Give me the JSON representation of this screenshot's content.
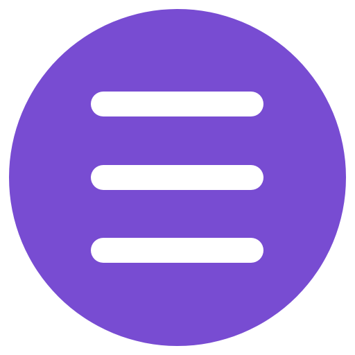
{
  "menu_button": {
    "icon": "hamburger-menu-icon",
    "background_color": "#784cd2",
    "line_color": "#ffffff",
    "line_count": 3
  }
}
